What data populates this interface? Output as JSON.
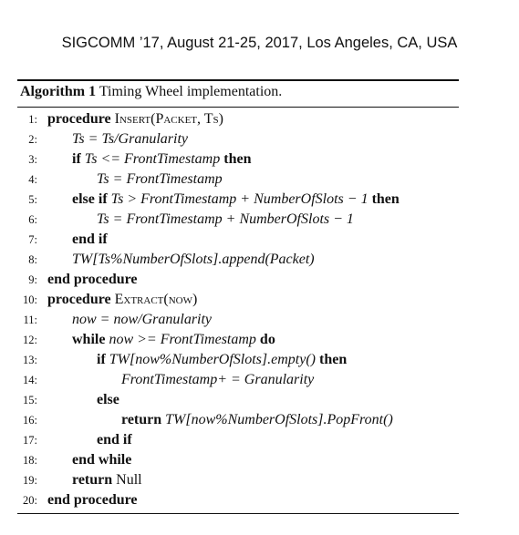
{
  "header": {
    "text": "SIGCOMM ’17, August 21-25, 2017, Los Angeles, CA, USA"
  },
  "caption": {
    "label": "Algorithm 1",
    "title": "Timing Wheel implementation."
  },
  "lines": [
    {
      "num": "1:",
      "kw": "procedure",
      "rest": "Insert(Packet, Ts)"
    },
    {
      "num": "2:",
      "rest": "Ts = Ts/Granularity"
    },
    {
      "num": "3:",
      "kw": "if",
      "rest": "Ts <= FrontTimestamp",
      "kw2": "then"
    },
    {
      "num": "4:",
      "rest": "Ts = FrontTimestamp"
    },
    {
      "num": "5:",
      "kw": "else if",
      "rest": "Ts > FrontTimestamp + NumberOfSlots − 1",
      "kw2": "then"
    },
    {
      "num": "6:",
      "rest": "Ts = FrontTimestamp + NumberOfSlots − 1"
    },
    {
      "num": "7:",
      "kw": "end if"
    },
    {
      "num": "8:",
      "rest": "TW[Ts%NumberOfSlots].append(Packet)"
    },
    {
      "num": "9:",
      "kw": "end procedure"
    },
    {
      "num": "10:",
      "kw": "procedure",
      "rest": "Extract(now)"
    },
    {
      "num": "11:",
      "rest": "now = now/Granularity"
    },
    {
      "num": "12:",
      "kw": "while",
      "rest": "now >= FrontTimestamp",
      "kw2": "do"
    },
    {
      "num": "13:",
      "kw": "if",
      "rest": "TW[now%NumberOfSlots].empty()",
      "kw2": "then"
    },
    {
      "num": "14:",
      "rest": "FrontTimestamp+ = Granularity"
    },
    {
      "num": "15:",
      "kw": "else"
    },
    {
      "num": "16:",
      "kw": "return",
      "rest": "TW[now%NumberOfSlots].PopFront()"
    },
    {
      "num": "17:",
      "kw": "end if"
    },
    {
      "num": "18:",
      "kw": "end while"
    },
    {
      "num": "19:",
      "kw": "return",
      "rest": "Null"
    },
    {
      "num": "20:",
      "kw": "end procedure"
    }
  ]
}
